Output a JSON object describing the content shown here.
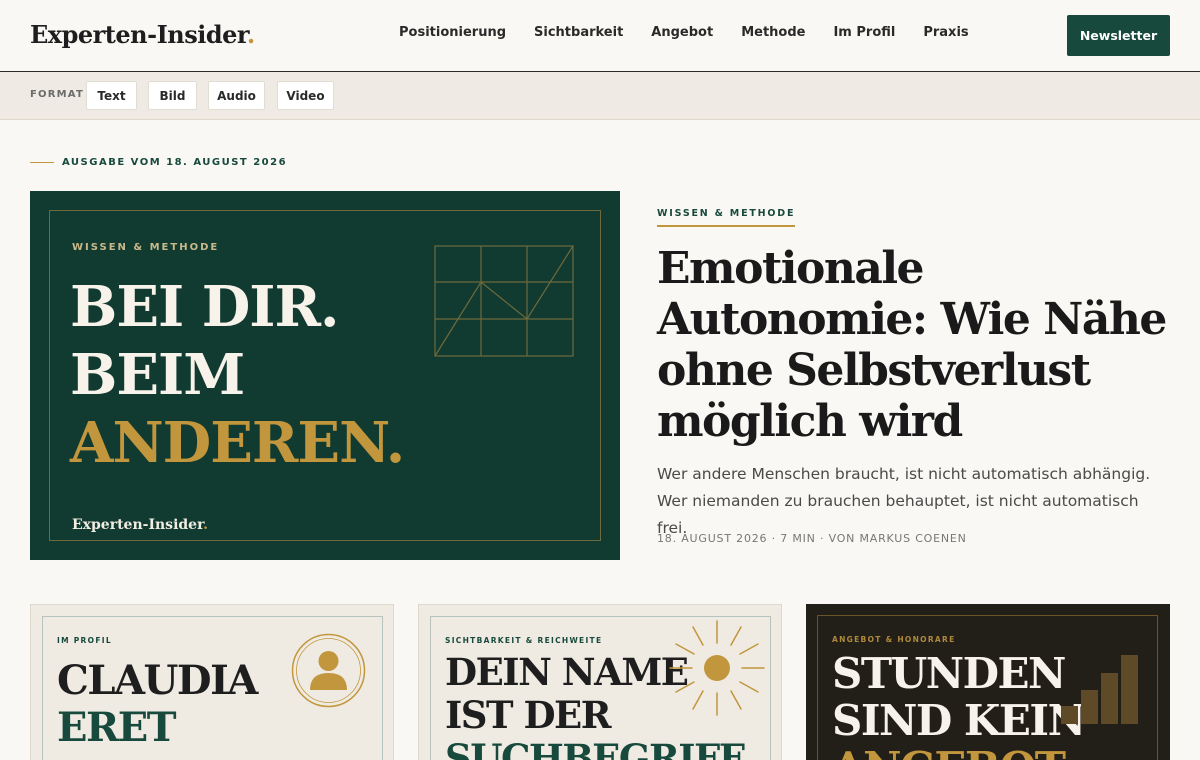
{
  "header": {
    "logo_text": "Experten-Insider",
    "logo_dot": ".",
    "nav": [
      "Positionierung",
      "Sichtbarkeit",
      "Angebot",
      "Methode",
      "Im Profil",
      "Praxis"
    ],
    "newsletter_label": "Newsletter"
  },
  "formatbar": {
    "label": "FORMAT",
    "chips": [
      "Text",
      "Bild",
      "Audio",
      "Video"
    ]
  },
  "edition": "AUSGABE VOM 18. AUGUST 2026",
  "hero_card": {
    "category": "WISSEN & METHODE",
    "line1": "BEI DIR.",
    "line2": "BEIM",
    "line3": "ANDEREN.",
    "logo_text": "Experten-Insider",
    "logo_dot": "."
  },
  "article": {
    "category": "WISSEN & METHODE",
    "title": "Emotionale Autonomie: Wie Nähe ohne Selbstverlust möglich wird",
    "lead": "Wer andere Menschen braucht, ist nicht automatisch abhängig. Wer niemanden zu brauchen behauptet, ist nicht automatisch frei.",
    "meta": "18. AUGUST 2026 · 7 MIN · VON MARKUS COENEN"
  },
  "cards": [
    {
      "category": "IM PROFIL",
      "line1": "CLAUDIA",
      "line2": "ERET"
    },
    {
      "category": "SICHTBARKEIT & REICHWEITE",
      "line1": "DEIN NAME",
      "line2": "IST DER",
      "line3": "SUCHBEGRIFF"
    },
    {
      "category": "ANGEBOT & HONORARE",
      "line1": "STUNDEN",
      "line2": "SIND KEIN",
      "line3": "ANGEBOT"
    }
  ],
  "colors": {
    "brand_green": "#17493c",
    "accent_gold": "#c2963c",
    "page_bg": "#faf8f4"
  }
}
